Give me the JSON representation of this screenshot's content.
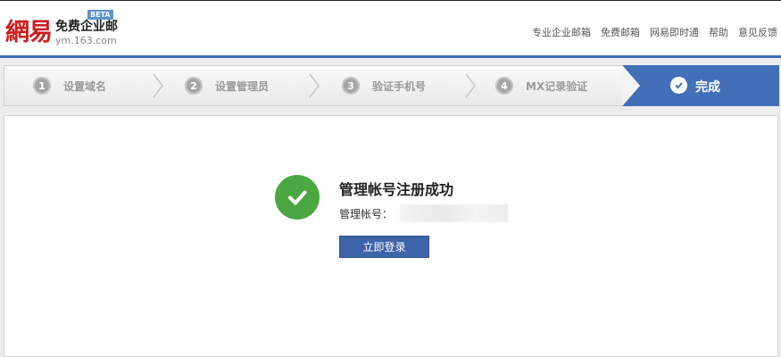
{
  "header": {
    "logo_mark": "網易",
    "logo_subtitle": "免费企业邮",
    "logo_domain": "ym.163.com",
    "beta_badge": "BETA",
    "nav": [
      {
        "label": "专业企业邮箱"
      },
      {
        "label": "免费邮箱"
      },
      {
        "label": "网易即时通"
      },
      {
        "label": "帮助"
      },
      {
        "label": "意见反馈"
      }
    ]
  },
  "steps": {
    "items": [
      {
        "num": "1",
        "label": "设置域名"
      },
      {
        "num": "2",
        "label": "设置管理员"
      },
      {
        "num": "3",
        "label": "验证手机号"
      },
      {
        "num": "4",
        "label": "MX记录验证"
      }
    ],
    "final": {
      "label": "完成"
    }
  },
  "result": {
    "title": "管理帐号注册成功",
    "account_label": "管理帐号：",
    "login_button": "立即登录"
  },
  "colors": {
    "brand_red": "#cf1c1c",
    "accent_blue": "#3b6bb4",
    "success_green": "#4aa742",
    "button_blue": "#3e65a9"
  }
}
